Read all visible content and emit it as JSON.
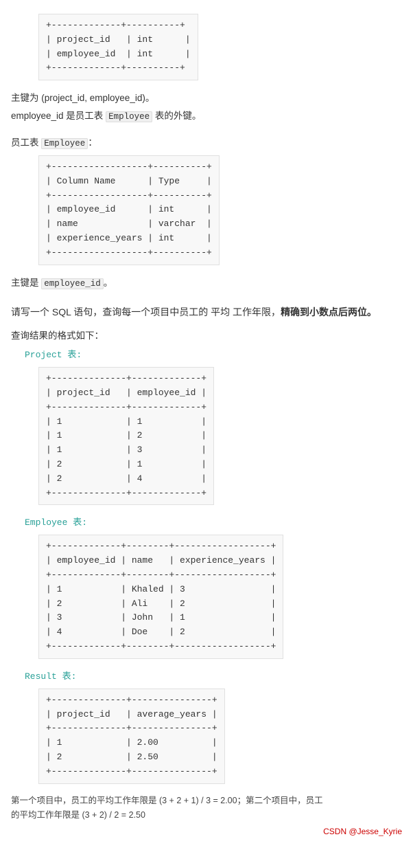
{
  "top_table": {
    "rows": [
      "| project_id   | int      |",
      "| employee_id  | int      |"
    ],
    "border_top": "+-------------+----------+",
    "border_mid": "+-------------+----------+",
    "border_bot": "+-------------+----------+"
  },
  "primary_key_note": "主键为 (project_id, employee_id)。",
  "foreign_key_note_prefix": "employee_id 是员工表 ",
  "foreign_key_code": "Employee",
  "foreign_key_note_suffix": " 表的外键。",
  "employee_table_label_prefix": "员工表 ",
  "employee_table_code": "Employee",
  "employee_table_label_suffix": "：",
  "employee_table": {
    "border": "+------------------+----------+",
    "header": "| Column Name      | Type     |",
    "rows": [
      "| employee_id      | int      |",
      "| name             | varchar  |",
      "| experience_years | int      |"
    ]
  },
  "primary_key_employee_prefix": "主键是 ",
  "primary_key_employee_code": "employee_id",
  "primary_key_employee_suffix": "。",
  "question_line1": "请写一个 SQL 语句，查询每一个项目中员工的 平均 工作年限，",
  "question_bold": "精确到小数点后两位。",
  "query_format_label": "查询结果的格式如下：",
  "project_table_label": "Project 表:",
  "project_table": {
    "border": "+--------------+-------------+",
    "header": "| project_id   | employee_id |",
    "rows": [
      "| 1            | 1           |",
      "| 1            | 2           |",
      "| 1            | 3           |",
      "| 2            | 1           |",
      "| 2            | 4           |"
    ]
  },
  "employee_sample_label": "Employee 表:",
  "employee_sample_table": {
    "border": "+-------------+--------+------------------+",
    "header": "| employee_id | name   | experience_years |",
    "rows": [
      "| 1           | Khaled | 3                |",
      "| 2           | Ali    | 2                |",
      "| 3           | John   | 1                |",
      "| 4           | Doe    | 2                |"
    ]
  },
  "result_label": "Result 表:",
  "result_table": {
    "border": "+--------------+---------------+",
    "header": "| project_id   | average_years |",
    "rows": [
      "| 1            | 2.00          |",
      "| 2            | 2.50          |"
    ]
  },
  "explanation_line1": "第一个项目中，员工的平均工作年限是 (3 + 2 + 1) / 3 = 2.00；第二个项目中，员工",
  "explanation_line2": "的平均工作年限是 (3 + 2) / 2 = 2.50",
  "csdn_credit": "CSDN @Jesse_Kyrie"
}
